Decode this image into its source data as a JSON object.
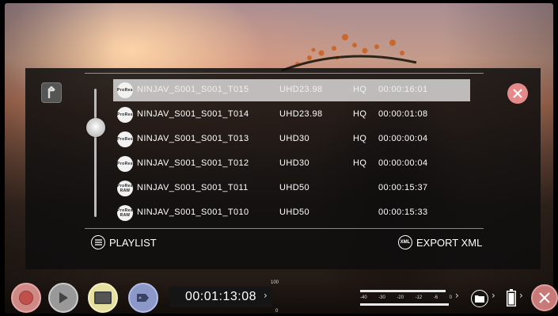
{
  "clips": [
    {
      "codec": "ProRes",
      "codec_sub": "",
      "name": "NINJAV_S001_S001_T015",
      "resolution": "UHD23.98",
      "quality": "HQ",
      "duration": "00:00:16:01",
      "selected": true
    },
    {
      "codec": "ProRes",
      "codec_sub": "",
      "name": "NINJAV_S001_S001_T014",
      "resolution": "UHD23.98",
      "quality": "HQ",
      "duration": "00:00:01:08",
      "selected": false
    },
    {
      "codec": "ProRes",
      "codec_sub": "",
      "name": "NINJAV_S001_S001_T013",
      "resolution": "UHD30",
      "quality": "HQ",
      "duration": "00:00:00:04",
      "selected": false
    },
    {
      "codec": "ProRes",
      "codec_sub": "",
      "name": "NINJAV_S001_S001_T012",
      "resolution": "UHD30",
      "quality": "HQ",
      "duration": "00:00:00:04",
      "selected": false
    },
    {
      "codec": "ProRes",
      "codec_sub": "RAW",
      "name": "NINJAV_S001_S001_T011",
      "resolution": "UHD50",
      "quality": "",
      "duration": "00:00:15:37",
      "selected": false
    },
    {
      "codec": "ProRes",
      "codec_sub": "RAW",
      "name": "NINJAV_S001_S001_T010",
      "resolution": "UHD50",
      "quality": "",
      "duration": "00:00:15:33",
      "selected": false
    }
  ],
  "footer": {
    "playlist_label": "PLAYLIST",
    "playlist_icon": "list-icon",
    "export_label": "EXPORT XML",
    "export_icon_text": "XML"
  },
  "panel": {
    "up_icon": "folder-up-icon",
    "close_icon": "close-icon"
  },
  "transport": {
    "timecode": "00:01:13:08",
    "level_top": "100",
    "level_bottom": "0",
    "meter_ticks": [
      "-40",
      "-30",
      "-20",
      "-12",
      "-6",
      "0"
    ]
  },
  "colors": {
    "record": "#d08a86",
    "monitor": "#e6e0a0",
    "tag": "#8b98c8",
    "close": "#e58a8a"
  }
}
